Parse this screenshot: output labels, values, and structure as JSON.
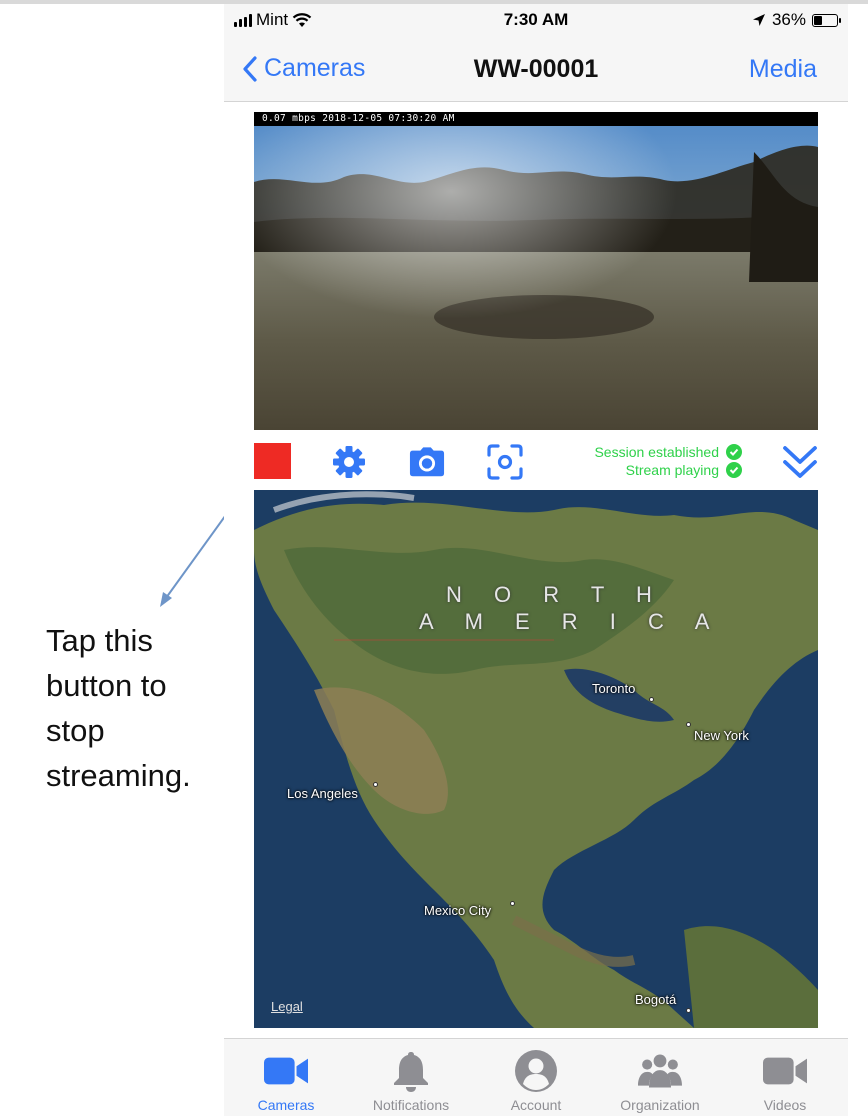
{
  "status_bar": {
    "carrier": "Mint",
    "time": "7:30 AM",
    "battery": "36%",
    "battery_level": 0.36
  },
  "nav": {
    "back_label": "Cameras",
    "title": "WW-00001",
    "right_label": "Media"
  },
  "video": {
    "overlay_text": "0.07 mbps 2018-12-05 07:30:20 AM"
  },
  "controls": {
    "status_messages": [
      "Session established",
      "Stream playing"
    ],
    "colors": {
      "stop": "#ee2a24",
      "accent": "#3478f6",
      "ok": "#2fd14a"
    }
  },
  "map": {
    "region_title_line1": "N O R T H",
    "region_title_line2": "A M E R I C A",
    "cities": [
      "Toronto",
      "New York",
      "Los Angeles",
      "Mexico City",
      "Bogotá"
    ],
    "legal": "Legal"
  },
  "tabs": [
    {
      "label": "Cameras",
      "icon": "video-camera-icon",
      "active": true
    },
    {
      "label": "Notifications",
      "icon": "bell-icon",
      "active": false
    },
    {
      "label": "Account",
      "icon": "person-icon",
      "active": false
    },
    {
      "label": "Organization",
      "icon": "group-icon",
      "active": false
    },
    {
      "label": "Videos",
      "icon": "video-camera-icon",
      "active": false
    }
  ],
  "annotation": {
    "text": "Tap this button to stop streaming."
  }
}
